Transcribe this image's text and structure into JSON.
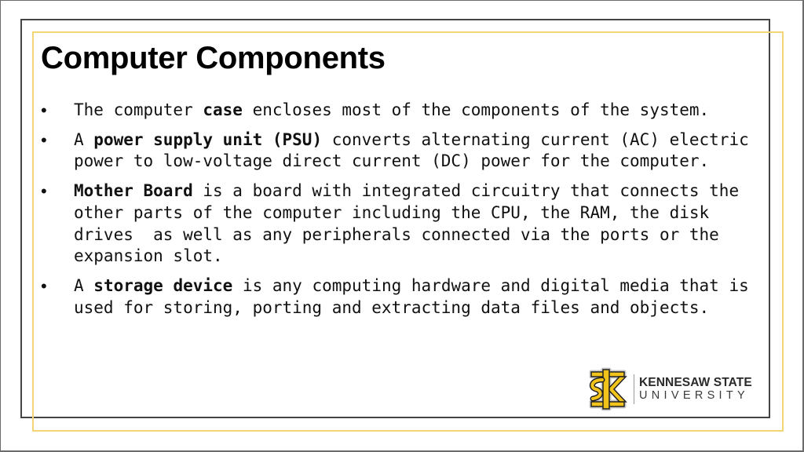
{
  "slide": {
    "title": "Computer Components",
    "bullets": [
      {
        "segments": [
          {
            "text": "The computer ",
            "bold": false
          },
          {
            "text": "case",
            "bold": true
          },
          {
            "text": " encloses most of the components of the system.",
            "bold": false
          }
        ]
      },
      {
        "segments": [
          {
            "text": "A ",
            "bold": false
          },
          {
            "text": "power supply unit (PSU)",
            "bold": true
          },
          {
            "text": " converts alternating current (AC) electric power to low-voltage direct current (DC) power for the computer.",
            "bold": false
          }
        ]
      },
      {
        "segments": [
          {
            "text": "Mother Board",
            "bold": true
          },
          {
            "text": " is a board with integrated circuitry that connects the other parts of the computer including the CPU, the RAM, the disk drives  as well as any peripherals connected via the ports or the expansion slot.",
            "bold": false
          }
        ]
      },
      {
        "segments": [
          {
            "text": "A ",
            "bold": false
          },
          {
            "text": "storage device",
            "bold": true
          },
          {
            "text": " is any computing hardware and digital media that is used for storing, porting and extracting data files and objects.",
            "bold": false
          }
        ]
      }
    ],
    "bullet_glyph": "•"
  },
  "logo": {
    "icon": "ks-monogram-icon",
    "line1": "KENNESAW STATE",
    "line2": "UNIVERSITY",
    "colors": {
      "gold": "#f2c31a",
      "dark": "#222222",
      "outline": "#bfbfbf"
    }
  },
  "theme": {
    "frame_dark": "#444444",
    "frame_gold": "#f2d675"
  }
}
